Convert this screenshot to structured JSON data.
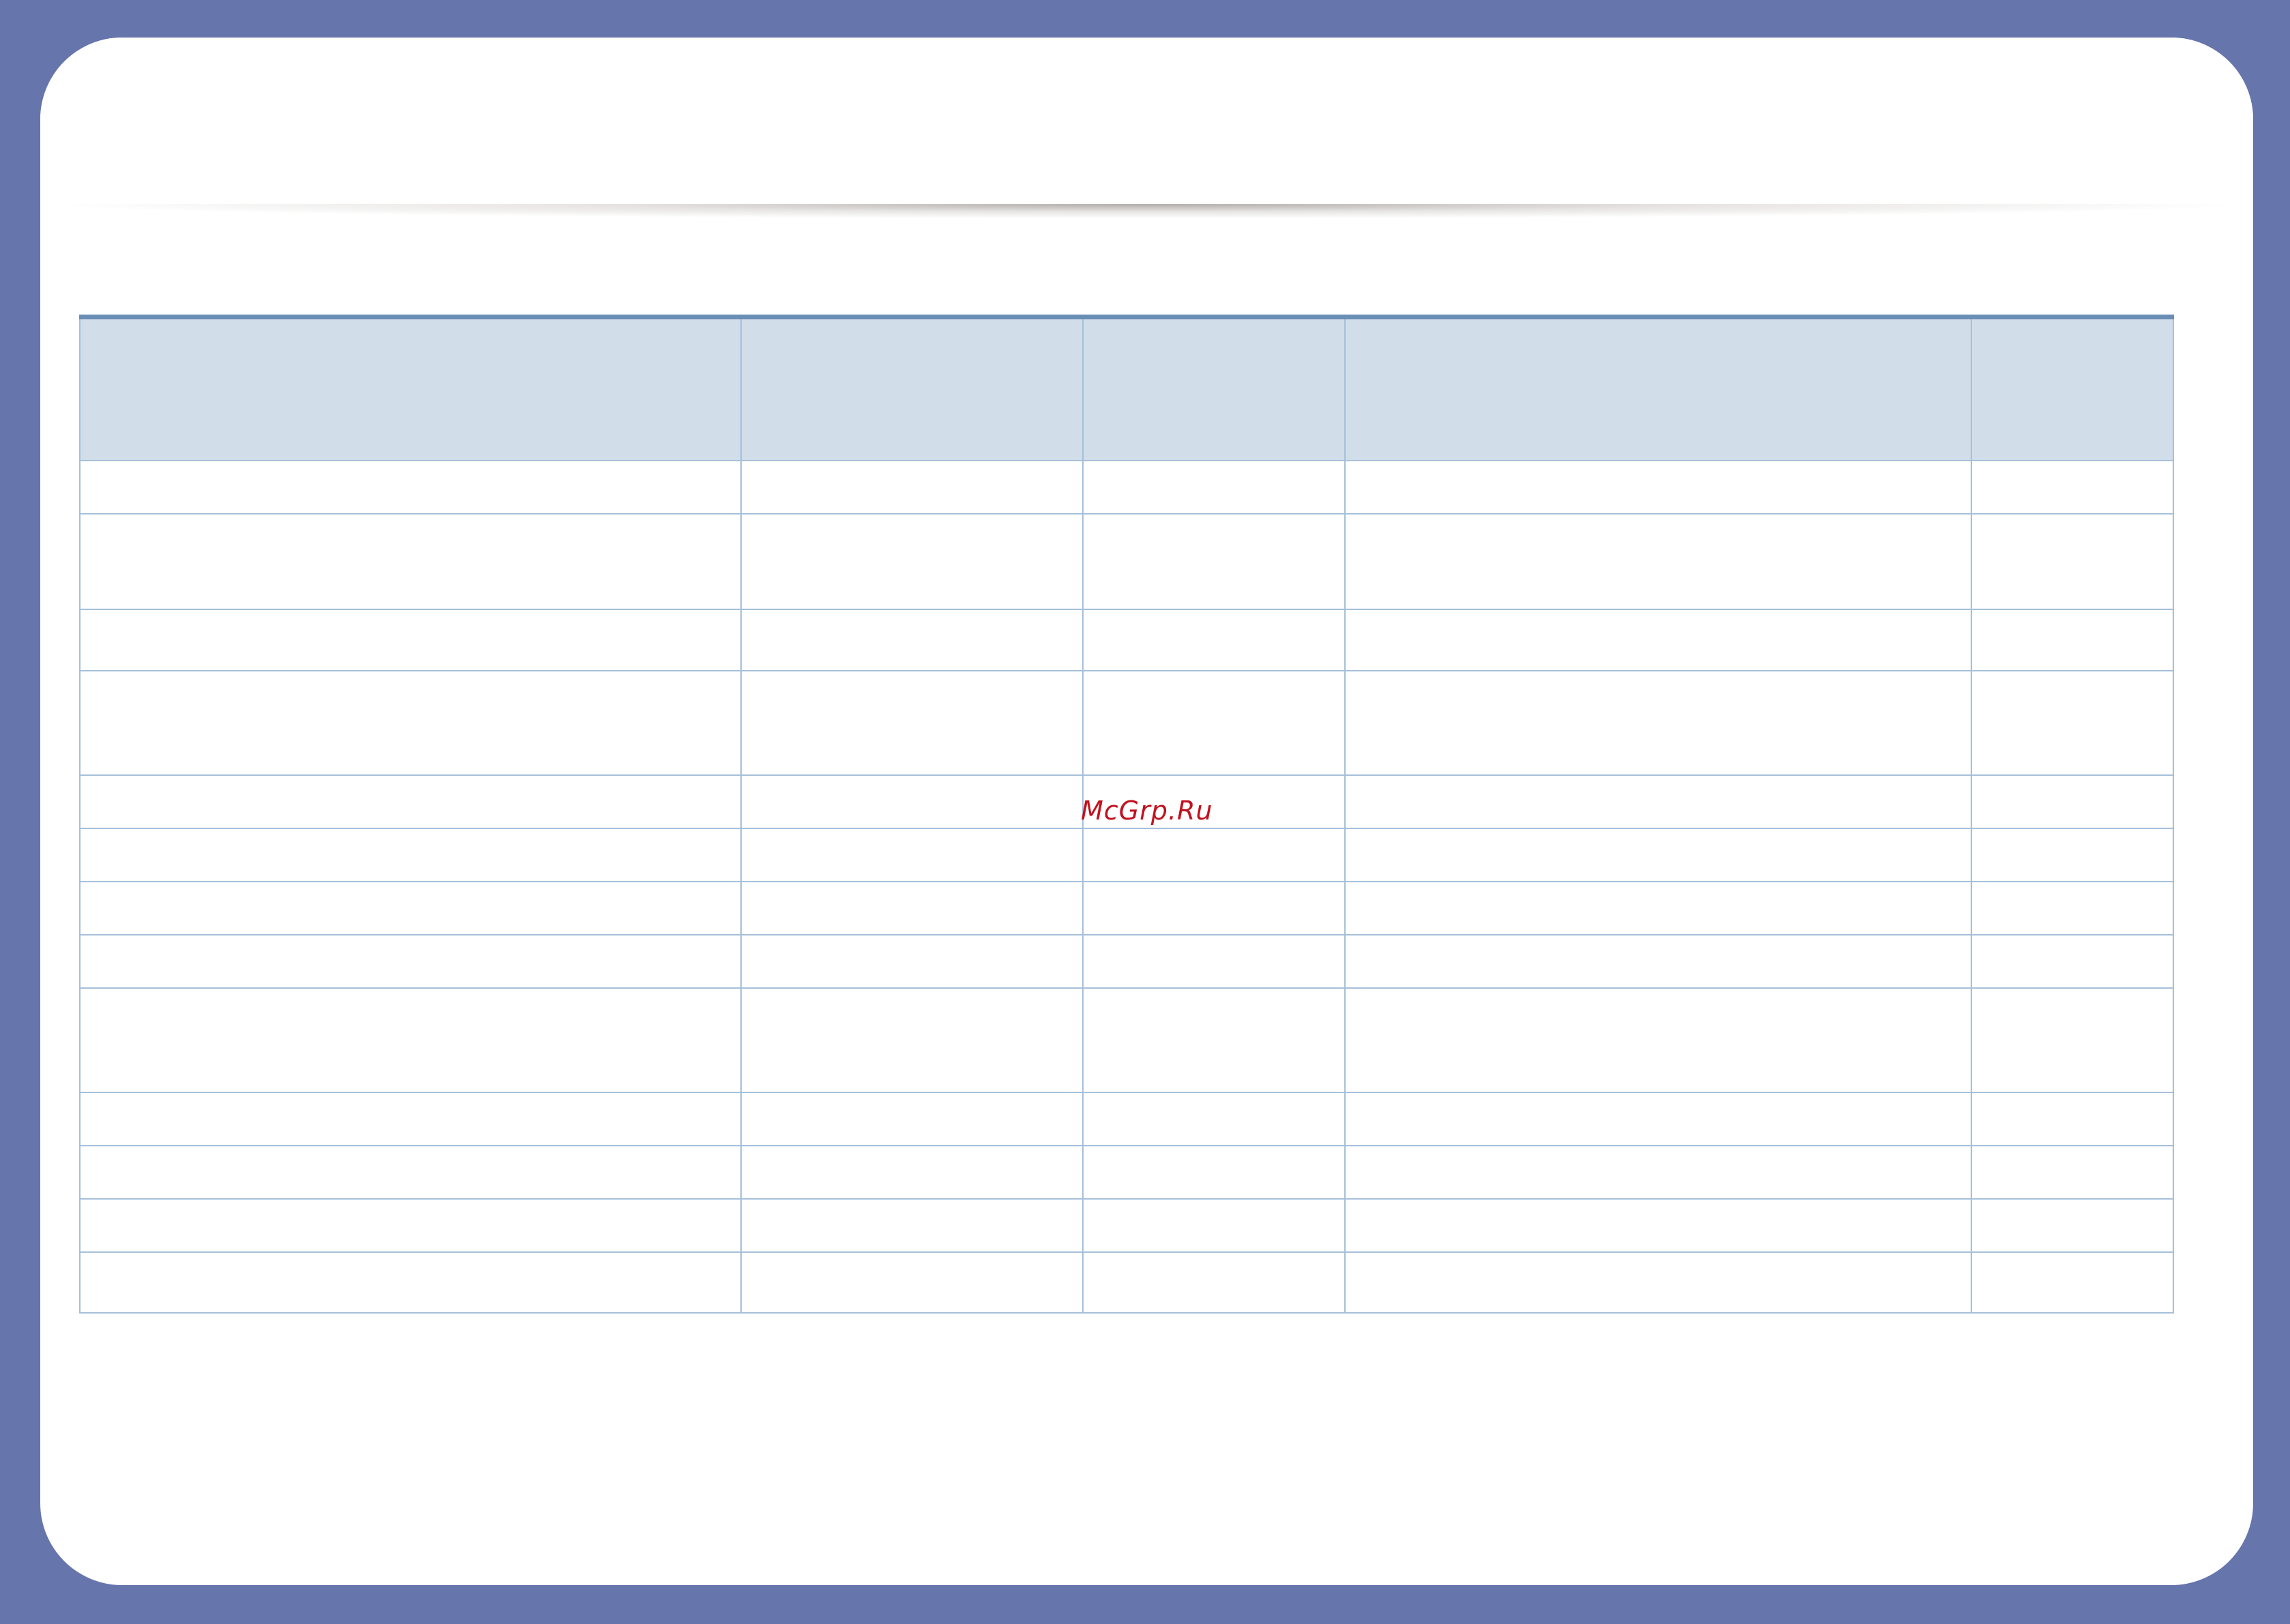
{
  "watermark": {
    "text": "McGrp.Ru"
  },
  "table": {
    "columns": [
      "",
      "",
      "",
      "",
      ""
    ],
    "rows": [
      [
        "",
        "",
        "",
        "",
        ""
      ],
      [
        "",
        "",
        "",
        "",
        ""
      ],
      [
        "",
        "",
        "",
        "",
        ""
      ],
      [
        "",
        "",
        "",
        "",
        ""
      ],
      [
        "",
        "",
        "",
        "",
        ""
      ],
      [
        "",
        "",
        "",
        "",
        ""
      ],
      [
        "",
        "",
        "",
        "",
        ""
      ],
      [
        "",
        "",
        "",
        "",
        ""
      ],
      [
        "",
        "",
        "",
        "",
        ""
      ],
      [
        "",
        "",
        "",
        "",
        ""
      ],
      [
        "",
        "",
        "",
        "",
        ""
      ],
      [
        "",
        "",
        "",
        "",
        ""
      ],
      [
        "",
        "",
        "",
        "",
        ""
      ]
    ]
  },
  "colors": {
    "frame": "#6675ab",
    "header_fill": "#d1dee9",
    "grid_line": "#a6c0d9",
    "header_rule": "#6a8eb5",
    "watermark": "#c1121f"
  }
}
